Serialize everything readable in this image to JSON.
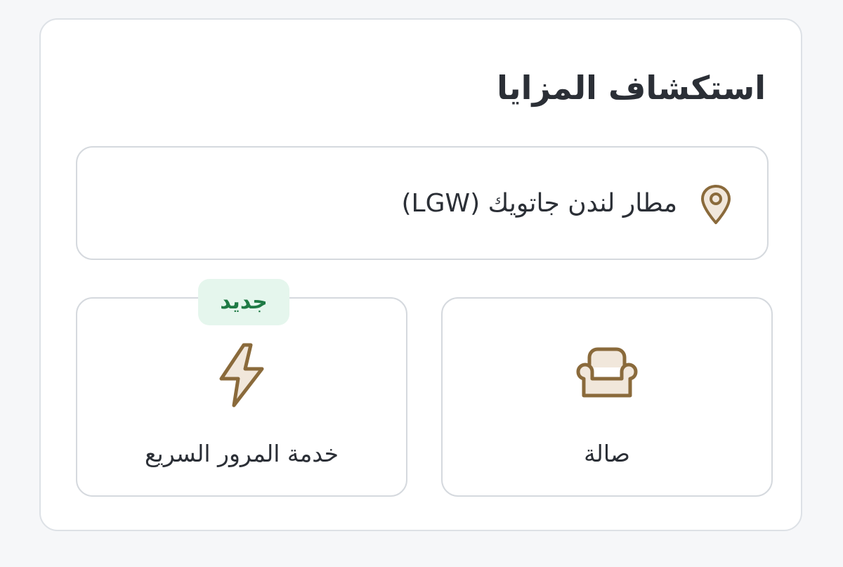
{
  "section": {
    "title": "استكشاف المزايا"
  },
  "airport": {
    "label": "مطار لندن جاتويك (LGW)",
    "icon": "location-pin-icon"
  },
  "features": {
    "fast_track": {
      "label": "خدمة المرور السريع",
      "badge": "جديد",
      "icon": "lightning-bolt-icon"
    },
    "lounge": {
      "label": "صالة",
      "icon": "armchair-icon"
    }
  },
  "colors": {
    "icon_stroke": "#8a6a3b",
    "icon_fill": "#f1e7db",
    "badge_bg": "#e5f6ed",
    "badge_text": "#1f7a45",
    "border": "#d5d9de"
  }
}
